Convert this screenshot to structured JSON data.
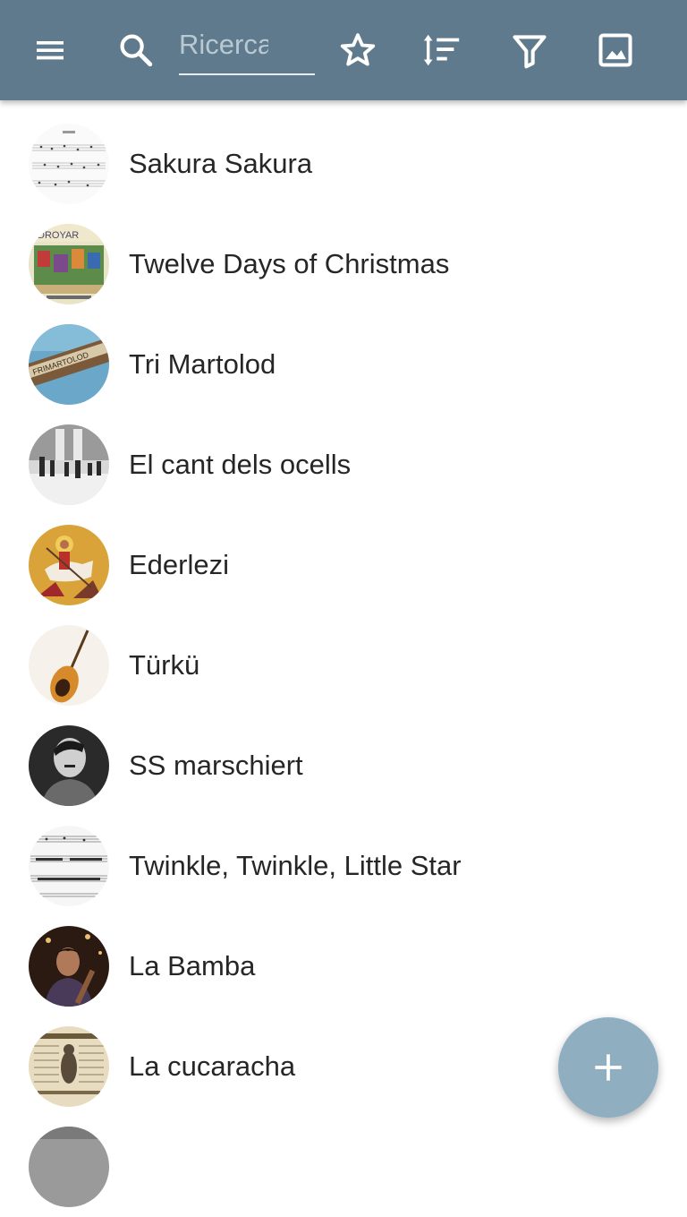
{
  "toolbar": {
    "background": "#5e7a8c",
    "menu_icon": "menu-icon",
    "search_icon": "search-icon",
    "search_placeholder": "Ricerca",
    "search_value": "",
    "favorite_icon": "star-outline-icon",
    "sort_icon": "sort-icon",
    "filter_icon": "filter-icon",
    "image_icon": "image-icon"
  },
  "songs": [
    {
      "title": "Sakura Sakura",
      "thumb": "sheet-music-thumbnail"
    },
    {
      "title": "Twelve Days of Christmas",
      "thumb": "illustrated-thumbnail"
    },
    {
      "title": "Tri Martolod",
      "thumb": "photo-thumbnail"
    },
    {
      "title": "El cant dels ocells",
      "thumb": "photo-thumbnail"
    },
    {
      "title": "Ederlezi",
      "thumb": "icon-painting-thumbnail"
    },
    {
      "title": "Türkü",
      "thumb": "instrument-thumbnail"
    },
    {
      "title": "SS marschiert",
      "thumb": "portrait-thumbnail"
    },
    {
      "title": "Twinkle, Twinkle, Little Star",
      "thumb": "sheet-music-thumbnail"
    },
    {
      "title": "La Bamba",
      "thumb": "photo-thumbnail"
    },
    {
      "title": "La cucaracha",
      "thumb": "poster-thumbnail"
    }
  ],
  "fab": {
    "icon": "plus-icon",
    "color": "#8fafc1"
  }
}
